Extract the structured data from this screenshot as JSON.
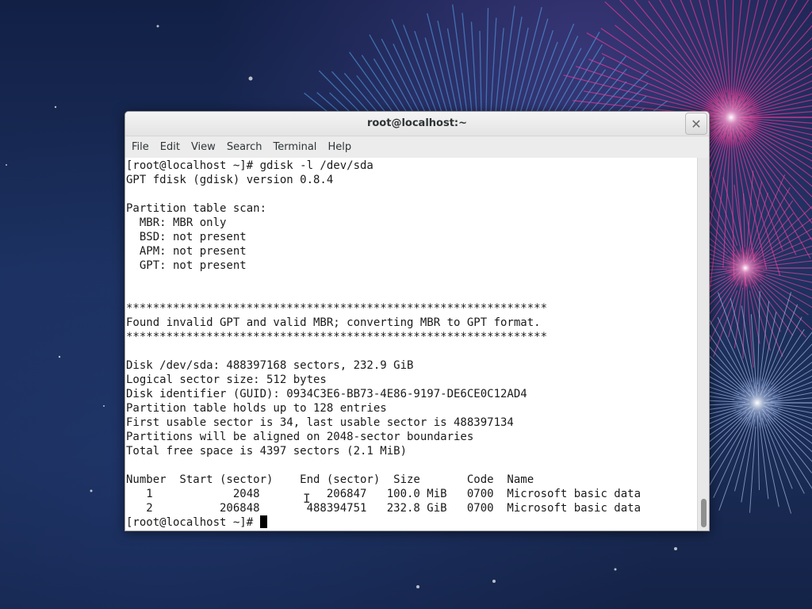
{
  "window": {
    "title": "root@localhost:~"
  },
  "menu": [
    "File",
    "Edit",
    "View",
    "Search",
    "Terminal",
    "Help"
  ],
  "terminal": {
    "lines": [
      "[root@localhost ~]# gdisk -l /dev/sda",
      "GPT fdisk (gdisk) version 0.8.4",
      "",
      "Partition table scan:",
      "  MBR: MBR only",
      "  BSD: not present",
      "  APM: not present",
      "  GPT: not present",
      "",
      "",
      "***************************************************************",
      "Found invalid GPT and valid MBR; converting MBR to GPT format.",
      "***************************************************************",
      "",
      "Disk /dev/sda: 488397168 sectors, 232.9 GiB",
      "Logical sector size: 512 bytes",
      "Disk identifier (GUID): 0934C3E6-BB73-4E86-9197-DE6CE0C12AD4",
      "Partition table holds up to 128 entries",
      "First usable sector is 34, last usable sector is 488397134",
      "Partitions will be aligned on 2048-sector boundaries",
      "Total free space is 4397 sectors (2.1 MiB)",
      "",
      "Number  Start (sector)    End (sector)  Size       Code  Name",
      "   1            2048          206847   100.0 MiB   0700  Microsoft basic data",
      "   2          206848       488394751   232.8 GiB   0700  Microsoft basic data"
    ],
    "prompt": "[root@localhost ~]# "
  },
  "colors": {
    "background": "#1b2f5c",
    "terminal_bg": "#ffffff",
    "text": "#1a1a1a"
  },
  "icons": {
    "close": "close-icon"
  }
}
